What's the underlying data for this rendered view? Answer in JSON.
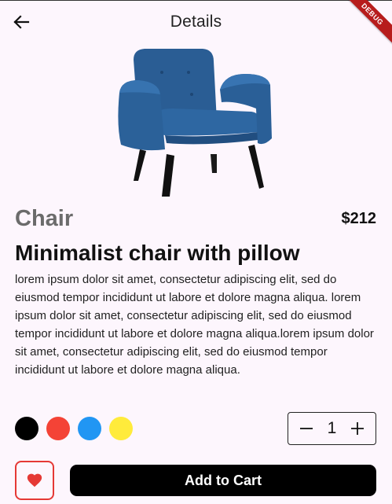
{
  "appbar": {
    "title": "Details",
    "back_icon": "arrow-left-icon"
  },
  "debug_banner": "DEBUG",
  "product": {
    "category": "Chair",
    "price": "$212",
    "title": "Minimalist chair with pillow",
    "description": "lorem ipsum dolor sit amet, consectetur adipiscing elit, sed do eiusmod tempor incididunt ut labore et dolore magna aliqua. lorem ipsum dolor sit amet, consectetur adipiscing elit, sed do eiusmod tempor incididunt ut labore et dolore magna aliqua.lorem ipsum dolor sit amet, consectetur adipiscing elit, sed do eiusmod tempor incididunt ut labore et dolore magna aliqua."
  },
  "colors": [
    "#000000",
    "#f44336",
    "#2196f3",
    "#ffeb3b"
  ],
  "quantity": {
    "value": "1",
    "decrement_icon": "minus-icon",
    "increment_icon": "plus-icon"
  },
  "favorite": {
    "icon": "heart-icon",
    "color": "#e53935"
  },
  "cart": {
    "label": "Add to Cart"
  }
}
